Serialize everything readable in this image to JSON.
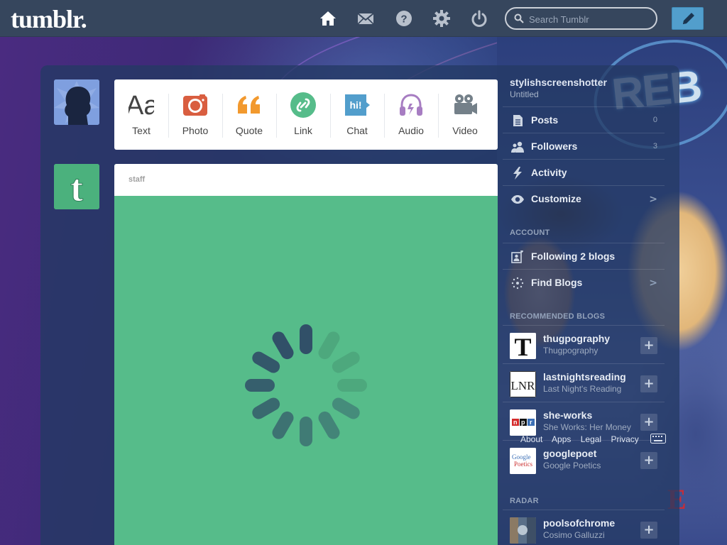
{
  "app": {
    "logo": "tumblr.",
    "search_placeholder": "Search Tumblr"
  },
  "topbar": {
    "icons": [
      "home-icon",
      "mail-icon",
      "help-icon",
      "settings-icon",
      "power-icon"
    ],
    "compose_icon": "pencil-icon"
  },
  "composer": {
    "types": [
      {
        "label": "Text",
        "icon": "text-icon",
        "color": "#444444"
      },
      {
        "label": "Photo",
        "icon": "camera-icon",
        "color": "#d95e40"
      },
      {
        "label": "Quote",
        "icon": "quote-icon",
        "color": "#f2992e"
      },
      {
        "label": "Link",
        "icon": "link-icon",
        "color": "#56bc8a"
      },
      {
        "label": "Chat",
        "icon": "chat-icon",
        "color": "#529ecc"
      },
      {
        "label": "Audio",
        "icon": "headphones-icon",
        "color": "#a77dc2"
      },
      {
        "label": "Video",
        "icon": "video-camera-icon",
        "color": "#748089"
      }
    ]
  },
  "post": {
    "author": "staff",
    "bg_color": "#56bc8a"
  },
  "sidebar": {
    "blog_name": "stylishscreenshotter",
    "blog_subtitle": "Untitled",
    "items": [
      {
        "label": "Posts",
        "count": "0",
        "icon": "posts-icon"
      },
      {
        "label": "Followers",
        "count": "3",
        "icon": "followers-icon"
      },
      {
        "label": "Activity",
        "count": "",
        "icon": "activity-icon"
      },
      {
        "label": "Customize",
        "count": "",
        "icon": "eye-icon",
        "chevron": ">"
      }
    ],
    "account_heading": "ACCOUNT",
    "account_items": [
      {
        "label": "Following 2 blogs",
        "icon": "following-icon"
      },
      {
        "label": "Find Blogs",
        "icon": "find-blogs-icon",
        "chevron": ">"
      }
    ],
    "recommended_heading": "RECOMMENDED BLOGS",
    "recommended": [
      {
        "name": "thugpography",
        "subtitle": "Thugpography"
      },
      {
        "name": "lastnightsreading",
        "subtitle": "Last Night's Reading"
      },
      {
        "name": "she-works",
        "subtitle": "She Works: Her Money"
      },
      {
        "name": "googlepoet",
        "subtitle": "Google Poetics"
      }
    ],
    "footer_links": [
      "About",
      "Apps",
      "Legal",
      "Privacy"
    ],
    "radar_heading": "RADAR",
    "radar": {
      "name": "poolsofchrome",
      "subtitle": "Cosimo Galluzzi"
    }
  }
}
